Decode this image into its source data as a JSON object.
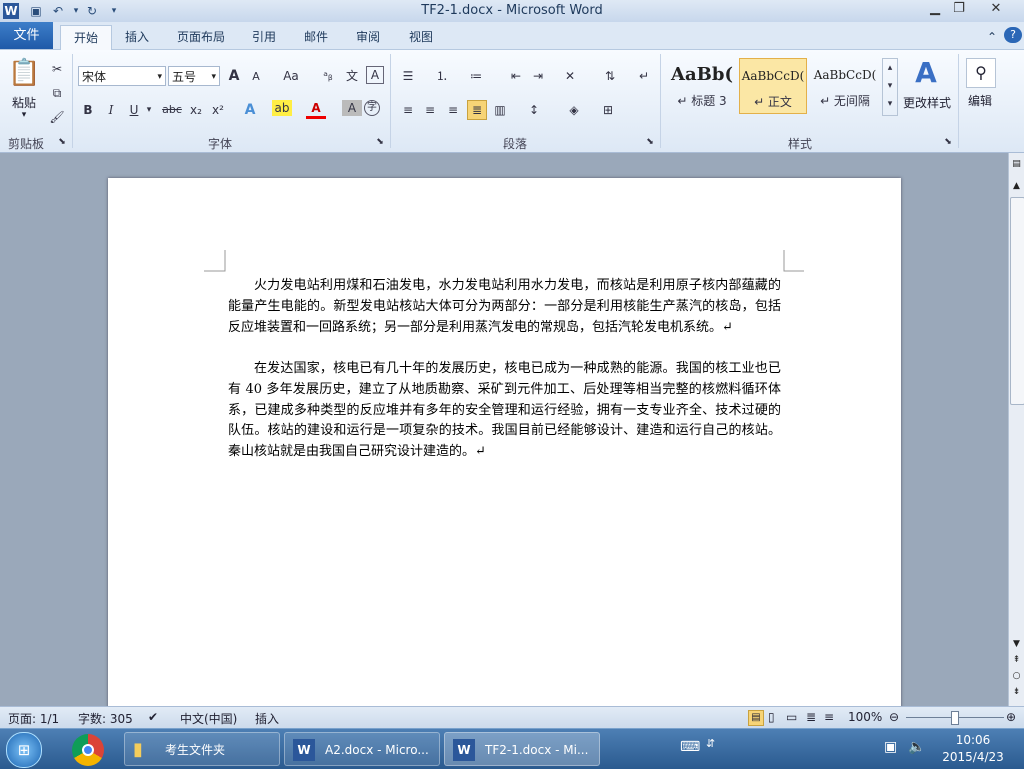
{
  "window": {
    "title": "TF2-1.docx - Microsoft Word"
  },
  "ribbon_tabs": [
    {
      "label": "文件"
    },
    {
      "label": "开始"
    },
    {
      "label": "插入"
    },
    {
      "label": "页面布局"
    },
    {
      "label": "引用"
    },
    {
      "label": "邮件"
    },
    {
      "label": "审阅"
    },
    {
      "label": "视图"
    }
  ],
  "clipboard": {
    "paste_label": "粘贴",
    "group_label": "剪贴板"
  },
  "font": {
    "family": "宋体",
    "size": "五号",
    "group_label": "字体",
    "grow_label": "A",
    "shrink_label": "A",
    "case_label": "Aa",
    "bold": "B",
    "italic": "I",
    "underline": "U",
    "strike": "abc",
    "sub": "x₂",
    "sup": "x²",
    "color_label": "A"
  },
  "paragraph": {
    "group_label": "段落"
  },
  "styles": {
    "group_label": "样式",
    "items": [
      {
        "sample": "AaBb(",
        "label": "↵ 标题 3"
      },
      {
        "sample": "AaBbCcD(",
        "label": "↵ 正文"
      },
      {
        "sample": "AaBbCcD(",
        "label": "↵ 无间隔"
      }
    ],
    "change_label": "更改样式"
  },
  "editing": {
    "label": "编辑"
  },
  "document": {
    "paragraphs": [
      "火力发电站利用煤和石油发电，水力发电站利用水力发电，而核站是利用原子核内部蕴藏的能量产生电能的。新型发电站核站大体可分为两部分：一部分是利用核能生产蒸汽的核岛，包括反应堆装置和一回路系统；另一部分是利用蒸汽发电的常规岛，包括汽轮发电机系统。↵",
      "在发达国家，核电已有几十年的发展历史，核电已成为一种成熟的能源。我国的核工业也已有 40 多年发展历史，建立了从地质勘察、采矿到元件加工、后处理等相当完整的核燃料循环体系，已建成多种类型的反应堆并有多年的安全管理和运行经验，拥有一支专业齐全、技术过硬的队伍。核站的建设和运行是一项复杂的技术。我国目前已经能够设计、建造和运行自己的核站。秦山核站就是由我国自己研究设计建造的。↵"
    ]
  },
  "status": {
    "page": "页面: 1/1",
    "words": "字数: 305",
    "language": "中文(中国)",
    "mode": "插入",
    "zoom": "100%"
  },
  "taskbar": {
    "items": [
      {
        "label": "考生文件夹"
      },
      {
        "label": "A2.docx - Micro..."
      },
      {
        "label": "TF2-1.docx - Mi..."
      }
    ],
    "time": "10:06",
    "date": "2015/4/23"
  },
  "colors": {
    "accent": "#2b579a",
    "taskbar": "#2a5a8f"
  }
}
